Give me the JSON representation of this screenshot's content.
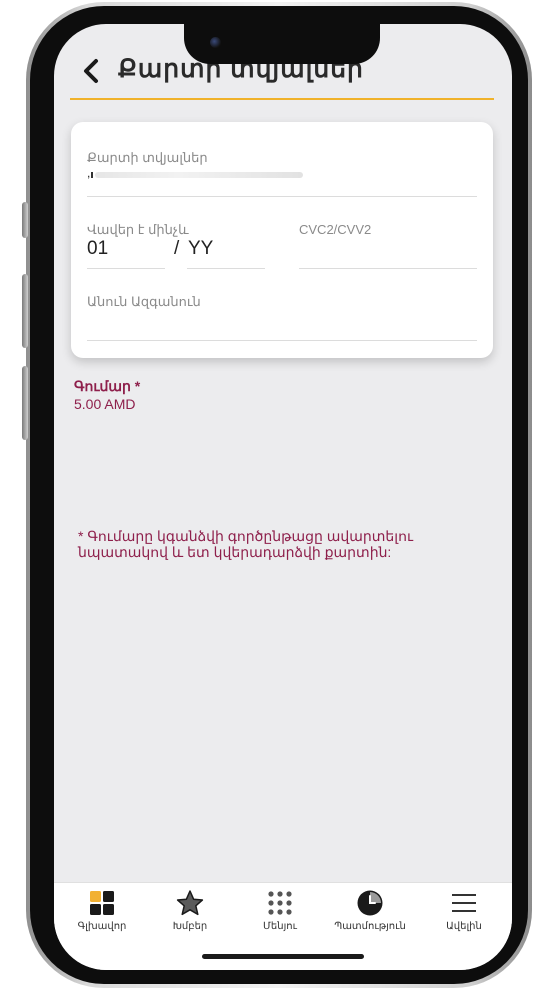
{
  "header": {
    "title": "Քարտի տվյալներ"
  },
  "card": {
    "card_number_label": "Քարտի տվյալներ",
    "card_number_value": ",",
    "expiry_label": "Վավեր է մինչև",
    "expiry_month": "01",
    "expiry_separator": "/",
    "expiry_year": "YY",
    "cvc_label": "CVC2/CVV2",
    "name_label": "Անուն Ազգանուն"
  },
  "amount": {
    "label": "Գումար *",
    "value": "5.00 AMD"
  },
  "note": "* Գումարը կգանձվի գործընթացը ավարտելու նպատակով և ետ կվերադարձվի քարտին:",
  "tabbar": {
    "items": [
      {
        "label": "Գլխավոր",
        "icon": "home-grid-icon"
      },
      {
        "label": "Խմբեր",
        "icon": "star-icon"
      },
      {
        "label": "Մենյու",
        "icon": "menu-dots-icon"
      },
      {
        "label": "Պատմություն",
        "icon": "history-clock-icon"
      },
      {
        "label": "Ավելին",
        "icon": "hamburger-icon"
      }
    ]
  },
  "colors": {
    "accent": "#f0b22a",
    "brand": "#8e1f4b",
    "home_tile": "#f2b133"
  }
}
